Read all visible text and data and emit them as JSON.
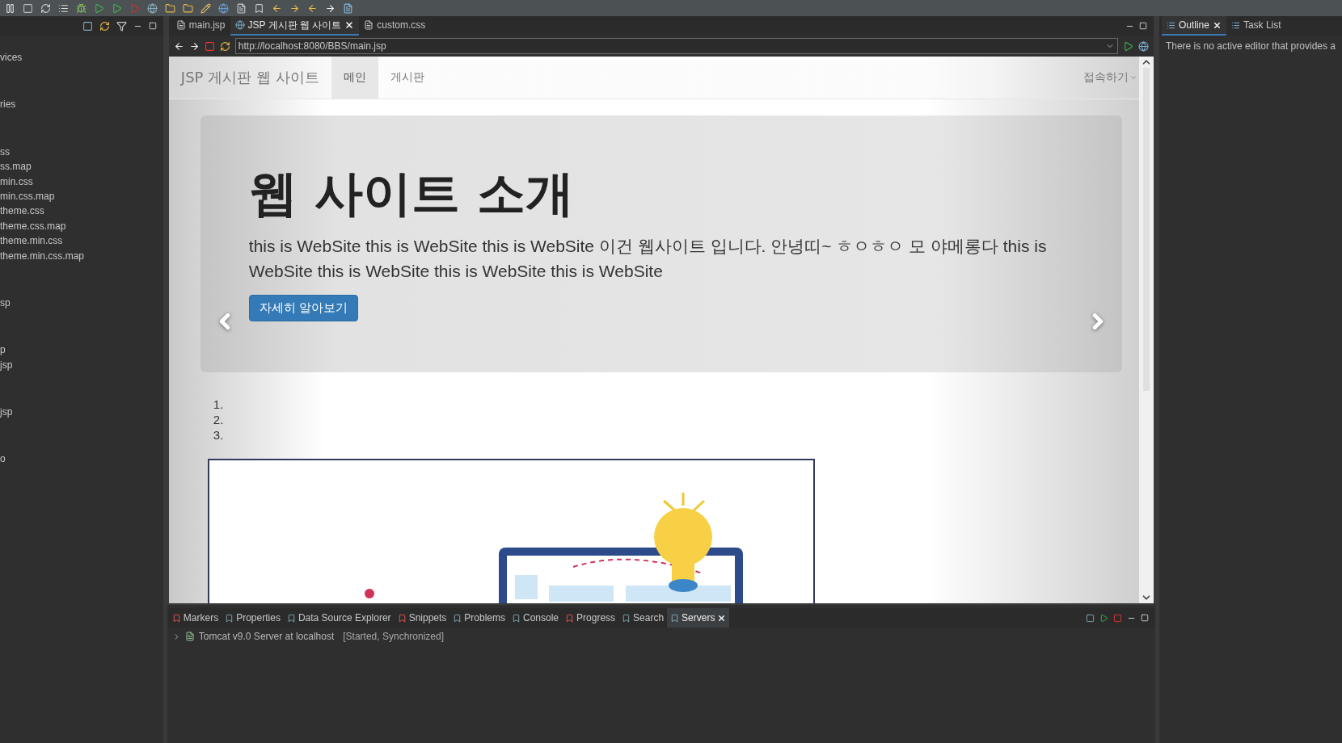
{
  "explorer": {
    "groups": [
      [
        "vices"
      ],
      [
        "ries"
      ],
      [
        "ss",
        "ss.map",
        "min.css",
        "min.css.map",
        "theme.css",
        "theme.css.map",
        "theme.min.css",
        "theme.min.css.map"
      ],
      [
        "sp"
      ],
      [
        "p",
        "jsp"
      ],
      [
        "jsp"
      ],
      [
        "o"
      ]
    ]
  },
  "editor_tabs": [
    {
      "label": "main.jsp",
      "kind": "file",
      "selected": false
    },
    {
      "label": "JSP 게시판 웹 사이트",
      "kind": "web",
      "selected": true
    },
    {
      "label": "custom.css",
      "kind": "file",
      "selected": false
    }
  ],
  "address_bar": {
    "value": "http://localhost:8080/BBS/main.jsp"
  },
  "page": {
    "brand": "JSP 게시판 웹 사이트",
    "nav": [
      {
        "label": "메인",
        "selected": true
      },
      {
        "label": "게시판",
        "selected": false
      }
    ],
    "dropdown": "접속하기",
    "jumbotron": {
      "title": "웹 사이트 소개",
      "text": "this is WebSite this is WebSite this is WebSite 이건 웹사이트 입니다. 안녕띠~ ㅎㅇㅎㅇ 모 야메롱다 this is WebSite this is WebSite this is WebSite this is WebSite",
      "button": "자세히 알아보기"
    },
    "list": [
      "1.",
      "2.",
      "3."
    ]
  },
  "right_tabs": [
    {
      "label": "Outline",
      "selected": true
    },
    {
      "label": "Task List",
      "selected": false
    }
  ],
  "outline_message": "There is no active editor that provides a",
  "bottom_tabs": [
    {
      "label": "Markers",
      "selected": false
    },
    {
      "label": "Properties",
      "selected": false
    },
    {
      "label": "Data Source Explorer",
      "selected": false
    },
    {
      "label": "Snippets",
      "selected": false
    },
    {
      "label": "Problems",
      "selected": false
    },
    {
      "label": "Console",
      "selected": false
    },
    {
      "label": "Progress",
      "selected": false
    },
    {
      "label": "Search",
      "selected": false
    },
    {
      "label": "Servers",
      "selected": true
    }
  ],
  "servers": [
    {
      "name": "Tomcat v9.0 Server at localhost",
      "status": "[Started, Synchronized]",
      "expanded": false
    }
  ]
}
